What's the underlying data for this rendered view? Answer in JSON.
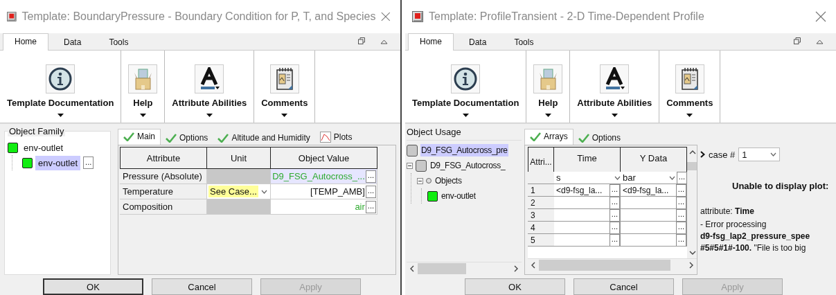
{
  "boundary_window": {
    "title": "Template: BoundaryPressure - Boundary Condition for P, T, and Species",
    "ribbon_tabs": [
      {
        "label": "Home",
        "selected": true
      },
      {
        "label": "Data",
        "selected": false
      },
      {
        "label": "Tools",
        "selected": false
      }
    ],
    "ribbon": [
      {
        "kind": "info",
        "label": "Template Documentation"
      },
      {
        "kind": "help",
        "label": "Help"
      },
      {
        "kind": "font",
        "label": "Attribute Abilities"
      },
      {
        "kind": "notes",
        "label": "Comments"
      }
    ],
    "family": {
      "title": "Object Family",
      "tree": [
        {
          "label": "env-outlet",
          "kind": "part",
          "selected": false,
          "children": [
            {
              "label": "env-outlet",
              "kind": "part",
              "selected": true,
              "button": "..."
            }
          ]
        }
      ]
    },
    "tabs": [
      {
        "label": "Main",
        "kind": "check",
        "selected": true
      },
      {
        "label": "Options",
        "kind": "check",
        "selected": false
      },
      {
        "label": "Altitude and Humidity",
        "kind": "check",
        "selected": false
      },
      {
        "label": "Plots",
        "kind": "plot",
        "selected": false
      }
    ],
    "table": {
      "columns": [
        "Attribute",
        "Unit",
        "Object Value"
      ],
      "rows": [
        {
          "attribute": "Pressure (Absolute)",
          "unit": {
            "kind": "blank"
          },
          "value": "D9_FSG_Autocross_...",
          "linked": true,
          "selected": true,
          "button": "..."
        },
        {
          "attribute": "Temperature",
          "unit": {
            "kind": "dropdown",
            "value": "See Case..."
          },
          "value": "[TEMP_AMB]",
          "linked": false,
          "selected": false,
          "button": "..."
        },
        {
          "attribute": "Composition",
          "unit": {
            "kind": "blank"
          },
          "value": "air",
          "linked": true,
          "selected": false,
          "button": "..."
        }
      ]
    },
    "buttons": [
      {
        "label": "OK",
        "focused": true,
        "disabled": false
      },
      {
        "label": "Cancel",
        "focused": false,
        "disabled": false
      },
      {
        "label": "Apply",
        "focused": false,
        "disabled": true
      }
    ]
  },
  "profile_window": {
    "title": "Template: ProfileTransient - 2-D Time-Dependent Profile",
    "ribbon_tabs": [
      {
        "label": "Home",
        "selected": true
      },
      {
        "label": "Data",
        "selected": false
      },
      {
        "label": "Tools",
        "selected": false
      }
    ],
    "ribbon": [
      {
        "kind": "info",
        "label": "Template Documentation"
      },
      {
        "kind": "help",
        "label": "Help"
      },
      {
        "kind": "font",
        "label": "Attribute Abilities"
      },
      {
        "kind": "notes",
        "label": "Comments"
      }
    ],
    "usage": {
      "title": "Object Usage",
      "tree": [
        {
          "label": "D9_FSG_Autocross_pre",
          "kind": "model",
          "selected": true
        },
        {
          "label": "D9_FSG_Autocross_",
          "kind": "model",
          "selected": false,
          "expanded": true,
          "children": [
            {
              "label": "Objects",
              "kind": "folder",
              "selected": false,
              "expanded": true,
              "children": [
                {
                  "label": "env-outlet",
                  "kind": "part",
                  "selected": false
                }
              ]
            }
          ]
        }
      ]
    },
    "tabs": [
      {
        "label": "Arrays",
        "kind": "check",
        "selected": true
      },
      {
        "label": "Options",
        "kind": "check",
        "selected": false
      }
    ],
    "arrays": {
      "columns": [
        "Attri...",
        "Time",
        "Y Data"
      ],
      "units": [
        {
          "value": "s"
        },
        {
          "value": "bar",
          "button": "..."
        }
      ],
      "rows": [
        {
          "index": "1",
          "cells": [
            {
              "value": "<d9-fsg_la...",
              "button": "..."
            },
            {
              "value": "<d9-fsg_la...",
              "button": "..."
            }
          ]
        },
        {
          "index": "2",
          "cells": [
            {
              "button": "..."
            },
            {
              "button": "..."
            }
          ]
        },
        {
          "index": "3",
          "cells": [
            {
              "button": "..."
            },
            {
              "button": "..."
            }
          ]
        },
        {
          "index": "4",
          "cells": [
            {
              "button": "..."
            },
            {
              "button": "..."
            }
          ]
        },
        {
          "index": "5",
          "cells": [
            {
              "button": "..."
            },
            {
              "button": "..."
            }
          ]
        }
      ]
    },
    "plot": {
      "case_label": "case #",
      "case_value": "1",
      "heading": "Unable to display plot:",
      "attribute": "attribute: **Time**",
      "error": "- Error processing\n**d9-fsg_lap2_pressure_spee**\n**#5#5#1#-100.** \"File is too big"
    },
    "buttons": [
      {
        "label": "OK",
        "focused": false,
        "disabled": false
      },
      {
        "label": "Cancel",
        "focused": false,
        "disabled": false
      },
      {
        "label": "Apply",
        "focused": false,
        "disabled": true
      }
    ]
  }
}
